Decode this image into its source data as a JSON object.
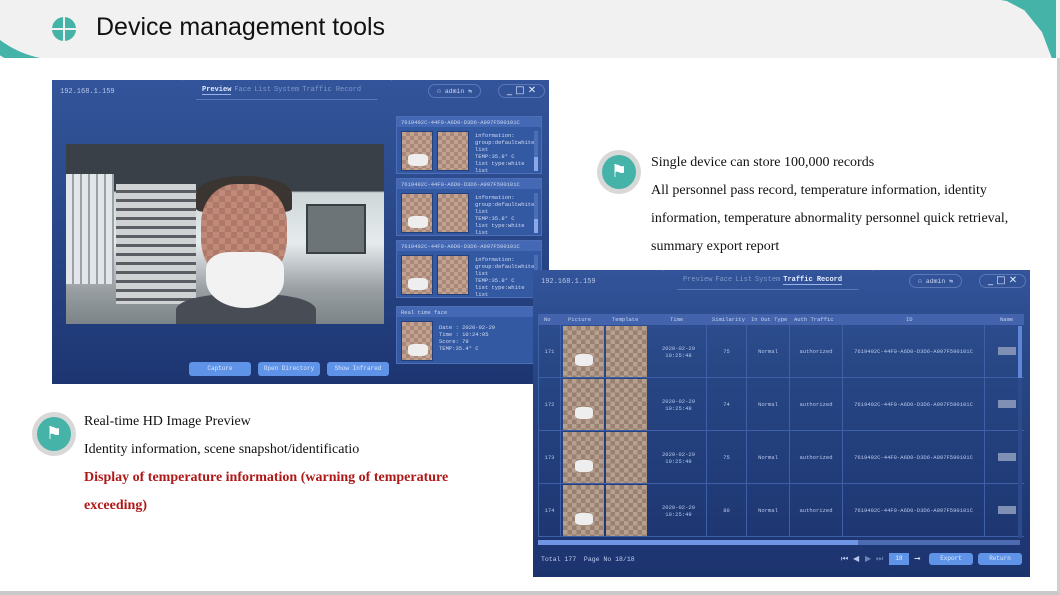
{
  "header": {
    "title": "Device management tools"
  },
  "preview_app": {
    "ip": "192.168.1.159",
    "tabs": [
      {
        "label": "Preview",
        "active": true
      },
      {
        "label": "Face",
        "active": false
      },
      {
        "label": "List",
        "active": false
      },
      {
        "label": "System",
        "active": false
      },
      {
        "label": "Traffic Record",
        "active": false
      }
    ],
    "user": "admin",
    "user_menu_glyph": "⇆",
    "window_controls": "_ □ ✕",
    "records": [
      {
        "id": "7619492C-44F0-A6D0-D3D6-A997F590101C",
        "info": "information:\ngroup:defaultwhite\nlist\nTEMP:35.8° C\nlist type:white\nlist"
      },
      {
        "id": "7619492C-44F0-A6D0-D3D6-A997F590101C",
        "info": "information:\ngroup:defaultwhite\nlist\nTEMP:35.8° C\nlist type:white\nlist"
      },
      {
        "id": "7619492C-44F0-A6D0-D3D6-A997F590101C",
        "info": "information:\ngroup:defaultwhite\nlist\nTEMP:35.8° C\nlist type:white\nlist"
      }
    ],
    "realtime": {
      "title": "Real time face",
      "info": "Date : 2020-02-29\nTime : 10:24:05\nScore: 79\nTEMP:35.4° C"
    },
    "buttons": {
      "capture": "Capture",
      "open_directory": "Open Directory",
      "show_infrared": "Show Infrared"
    }
  },
  "record_app": {
    "ip": "192.168.1.159",
    "tabs": [
      {
        "label": "Preview",
        "active": false
      },
      {
        "label": "Face",
        "active": false
      },
      {
        "label": "List",
        "active": false
      },
      {
        "label": "System",
        "active": false
      },
      {
        "label": "Traffic Record",
        "active": true
      }
    ],
    "user": "admin",
    "user_menu_glyph": "⇆",
    "window_controls": "_ □ ✕",
    "columns": [
      "No",
      "Picture",
      "Template",
      "Time",
      "Similarity",
      "In Out Type",
      "Auth Traffic",
      "ID",
      "Name"
    ],
    "rows": [
      {
        "no": "171",
        "time": "2020-02-29\n10:25:48",
        "similarity": "75",
        "inout": "Normal",
        "auth": "authorized",
        "id": "7619492C-44F0-A6D0-D3D6-A997F590101C"
      },
      {
        "no": "172",
        "time": "2020-02-29\n10:25:48",
        "similarity": "74",
        "inout": "Normal",
        "auth": "authorized",
        "id": "7619492C-44F0-A6D0-D3D6-A997F590101C"
      },
      {
        "no": "173",
        "time": "2020-02-29\n10:25:49",
        "similarity": "75",
        "inout": "Normal",
        "auth": "authorized",
        "id": "7619492C-44F0-A6D0-D3D6-A997F590101C"
      },
      {
        "no": "174",
        "time": "2020-02-29\n10:25:49",
        "similarity": "80",
        "inout": "Normal",
        "auth": "authorized",
        "id": "7619492C-44F0-A6D0-D3D6-A997F590101C"
      }
    ],
    "footer": {
      "total": "Total 177",
      "page": "Page No 18/18"
    },
    "pager": {
      "first": "⏮",
      "prev": "◀",
      "next": "▶",
      "last": "⏭",
      "page_input": "18",
      "go": "➞"
    },
    "buttons": {
      "export": "Export",
      "return": "Return"
    }
  },
  "bullet_right": {
    "icon": "signpost-icon",
    "lines": [
      "Single device can store 100,000 records",
      "All personnel pass record, temperature information, identity",
      "information, temperature abnormality personnel quick retrieval,",
      "summary export report"
    ]
  },
  "bullet_left": {
    "icon": "signpost-icon",
    "lines": [
      "Real-time HD Image Preview",
      "Identity information, scene snapshot/identificatio"
    ],
    "highlight_lines": [
      "Display of temperature information (warning of temperature",
      "exceeding)"
    ],
    "highlight_color": "#b01818"
  },
  "colors": {
    "accent": "#45b3a8",
    "app_bg": "#2b4a8c",
    "button": "#5f93e8"
  }
}
